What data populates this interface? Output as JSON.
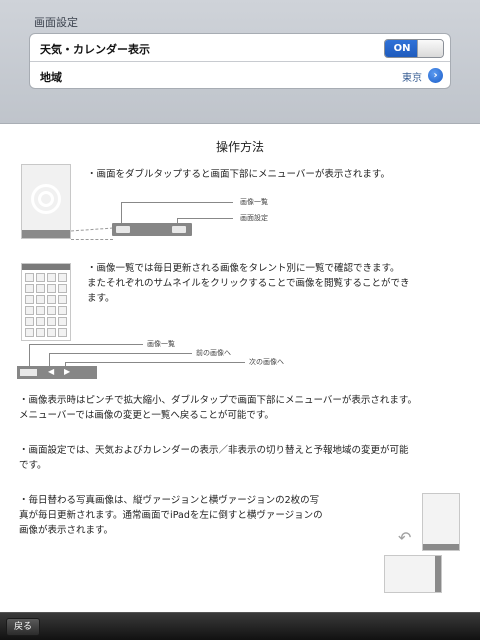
{
  "settings": {
    "section_title": "画面設定",
    "weather_calendar_label": "天気・カレンダー表示",
    "toggle_state": "ON",
    "region_label": "地域",
    "region_value": "東京"
  },
  "instructions": {
    "title": "操作方法",
    "p1": "・画面をダブルタップすると画面下部にメニューバーが表示されます。",
    "fig1_label_list": "画像一覧",
    "fig1_label_settings": "画面設定",
    "p2_line1": "・画像一覧では毎日更新される画像をタレント別に一覧で確認できます。",
    "p2_line2": "またそれぞれのサムネイルをクリックすることで画像を閲覧することができ",
    "p2_line3": "ます。",
    "fig3_label_list": "画像一覧",
    "fig3_label_prev": "前の画像へ",
    "fig3_label_next": "次の画像へ",
    "p3_line1": "・画像表示時はピンチで拡大縮小、ダブルタップで画面下部にメニューバーが表示されます。",
    "p3_line2": "メニューバーでは画像の変更と一覧へ戻ることが可能です。",
    "p4_line1": "・画面設定では、天気およびカレンダーの表示／非表示の切り替えと予報地域の変更が可能",
    "p4_line2": "です。",
    "p5_line1": "・毎日替わる写真画像は、縦ヴァージョンと横ヴァージョンの2枚の写",
    "p5_line2": "真が毎日更新されます。通常画面でiPadを左に倒すと横ヴァージョンの",
    "p5_line3": "画像が表示されます。"
  },
  "toolbar": {
    "back_label": "戻る"
  },
  "icons": {
    "disclosure": "chevron-right-circle-icon",
    "prev": "triangle-left-icon",
    "next": "triangle-right-icon",
    "rotate": "rotate-arrow-icon"
  }
}
